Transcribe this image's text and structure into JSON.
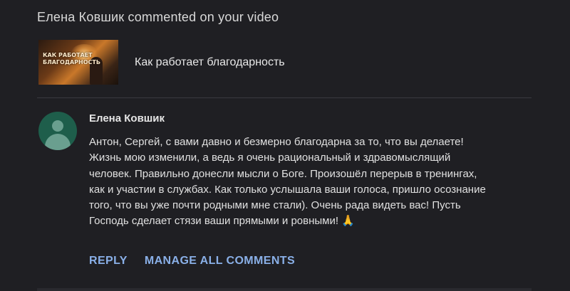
{
  "notification": {
    "header": "Елена Ковшик commented on your video"
  },
  "video": {
    "thumbnail_text": "КАК РАБОТАЕТ\nБЛАГОДАРНОСТЬ",
    "title": "Как работает благодарность"
  },
  "comment": {
    "author": "Елена Ковшик",
    "text": "Антон, Сергей, с вами давно и безмерно благодарна за то, что вы делаете!\nЖизнь мою изменили, а ведь я очень рациональный и здравомыслящий\nчеловек. Правильно донесли мысли о Боге. Произошёл перерыв в тренингах,\nкак и участии в службах. Как только услышала ваши голоса, пришло осознание\nтого, что вы уже почти родными мне стали). Очень рада видеть вас! Пусть\nГосподь сделает стязи ваши прямыми и ровными! 🙏",
    "avatar_icon": "person-icon"
  },
  "actions": {
    "reply_label": "REPLY",
    "manage_label": "MANAGE ALL COMMENTS"
  },
  "colors": {
    "background": "#1f1f23",
    "action_blue": "#8ab0e8",
    "avatar_bg": "#1e5e4b"
  }
}
